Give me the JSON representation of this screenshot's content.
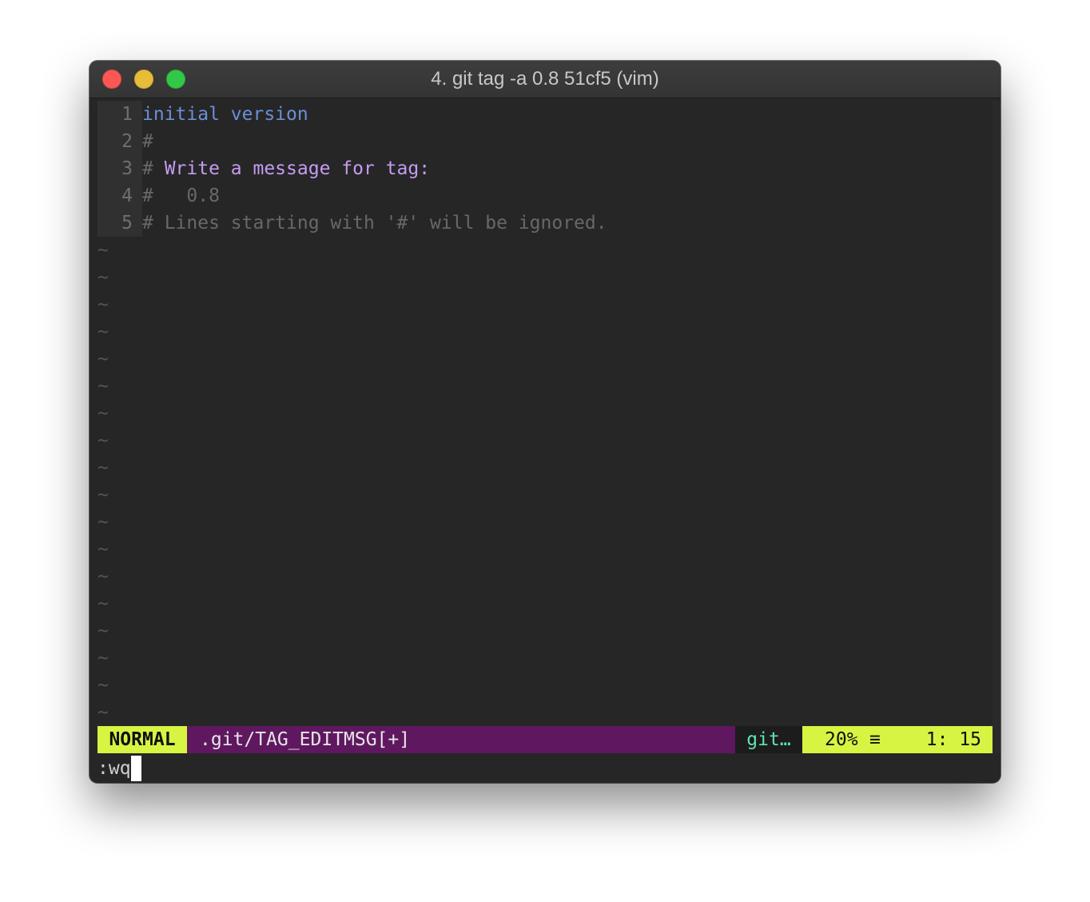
{
  "window": {
    "title": "4. git tag -a 0.8 51cf5 (vim)"
  },
  "buffer": {
    "lines": [
      {
        "num": "1",
        "parts": [
          {
            "text": "initial version",
            "cls": "kw-blue"
          }
        ]
      },
      {
        "num": "2",
        "parts": [
          {
            "text": "#",
            "cls": "comment"
          }
        ]
      },
      {
        "num": "3",
        "parts": [
          {
            "text": "# ",
            "cls": "comment"
          },
          {
            "text": "Write a message for tag:",
            "cls": "purple"
          }
        ]
      },
      {
        "num": "4",
        "parts": [
          {
            "text": "#   0.8",
            "cls": "comment"
          }
        ]
      },
      {
        "num": "5",
        "parts": [
          {
            "text": "# Lines starting with '#' will be ignored.",
            "cls": "comment"
          }
        ]
      }
    ],
    "empty_marker": "~",
    "empty_line_count": 18
  },
  "statusline": {
    "mode": "NORMAL",
    "filename": ".git/TAG_EDITMSG[+]",
    "filetype": "git…",
    "percent": "20%",
    "menu_glyph": "≡",
    "position": "1: 15"
  },
  "cmdline": {
    "text": ":wq"
  },
  "colors": {
    "mode_bg": "#d7f442",
    "file_bg": "#5f1860",
    "filetype_fg": "#5fe3b0",
    "keyword": "#6b8fd6",
    "accent_purple": "#c59bf2"
  }
}
